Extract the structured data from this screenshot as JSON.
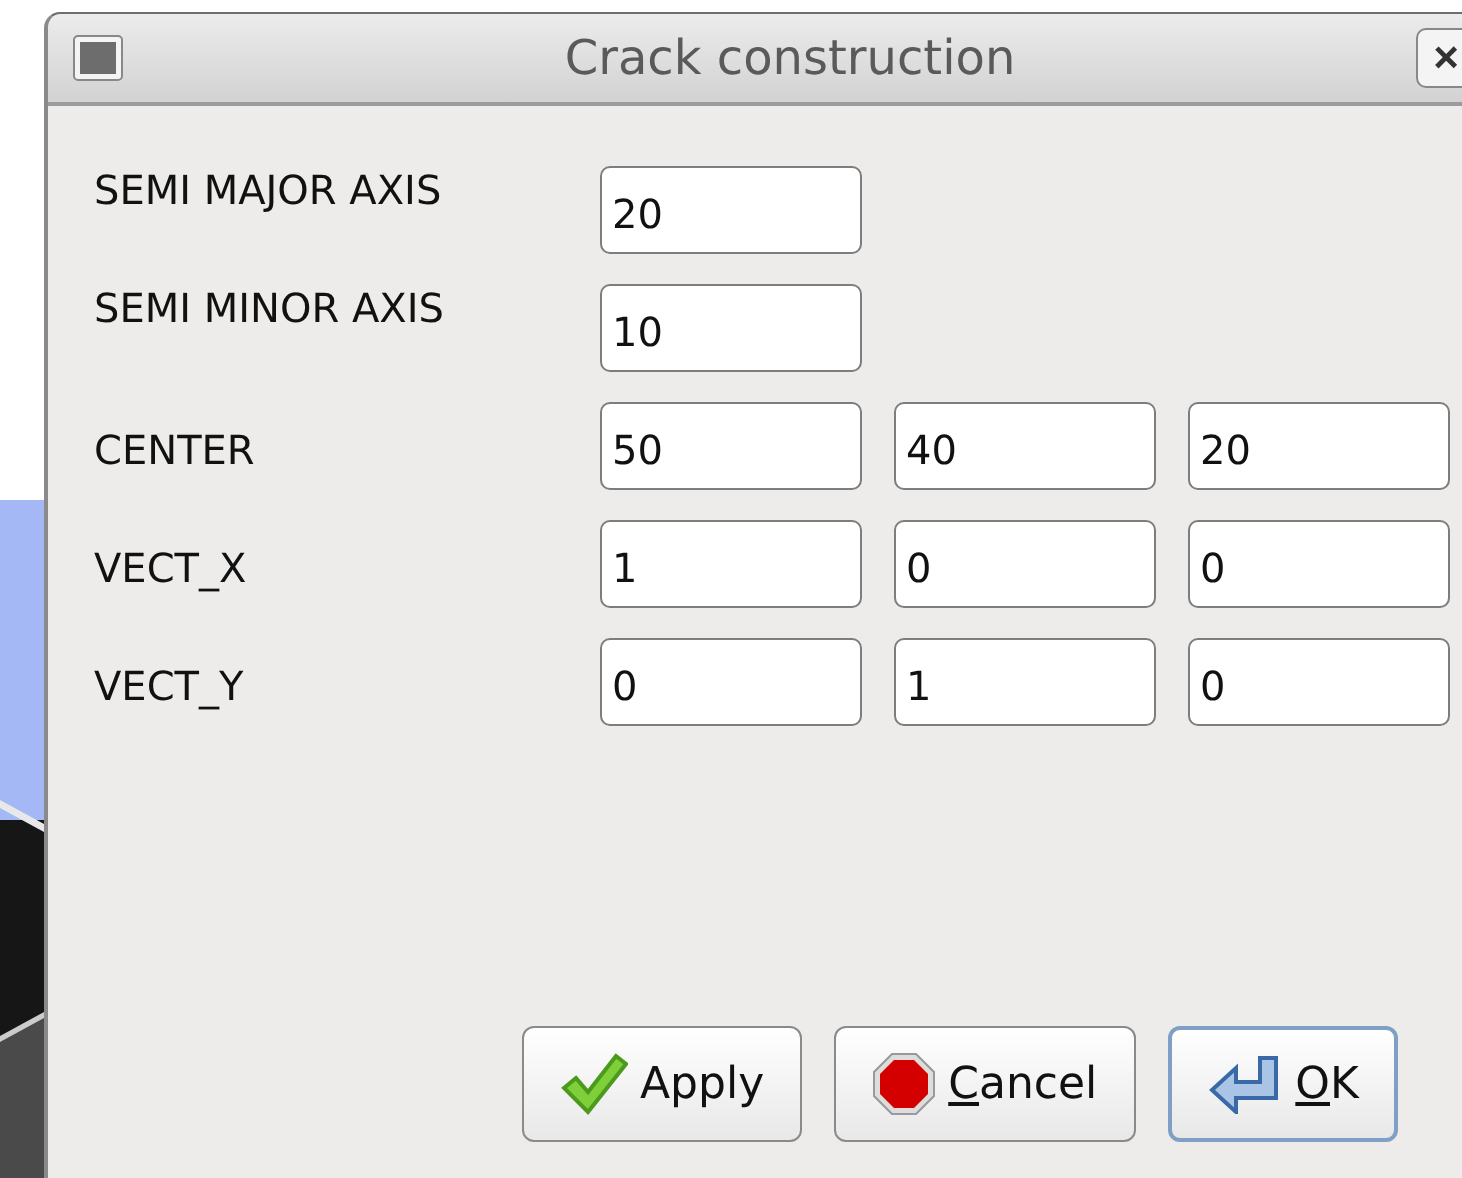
{
  "window": {
    "title": "Crack construction",
    "close": "×"
  },
  "fields": [
    {
      "label": "SEMI MAJOR AXIS",
      "values": [
        "20"
      ]
    },
    {
      "label": "SEMI MINOR AXIS",
      "values": [
        "10"
      ]
    },
    {
      "label": "CENTER",
      "values": [
        "50",
        "40",
        "20"
      ]
    },
    {
      "label": "VECT_X",
      "values": [
        "1",
        "0",
        "0"
      ]
    },
    {
      "label": "VECT_Y",
      "values": [
        "0",
        "1",
        "0"
      ]
    }
  ],
  "buttons": [
    {
      "label": "Apply",
      "kind": "apply",
      "mnemonic": false,
      "default": false
    },
    {
      "label": "Cancel",
      "kind": "cancel",
      "mnemonic": true,
      "default": false
    },
    {
      "label": "OK",
      "kind": "ok",
      "mnemonic": true,
      "default": true
    }
  ]
}
